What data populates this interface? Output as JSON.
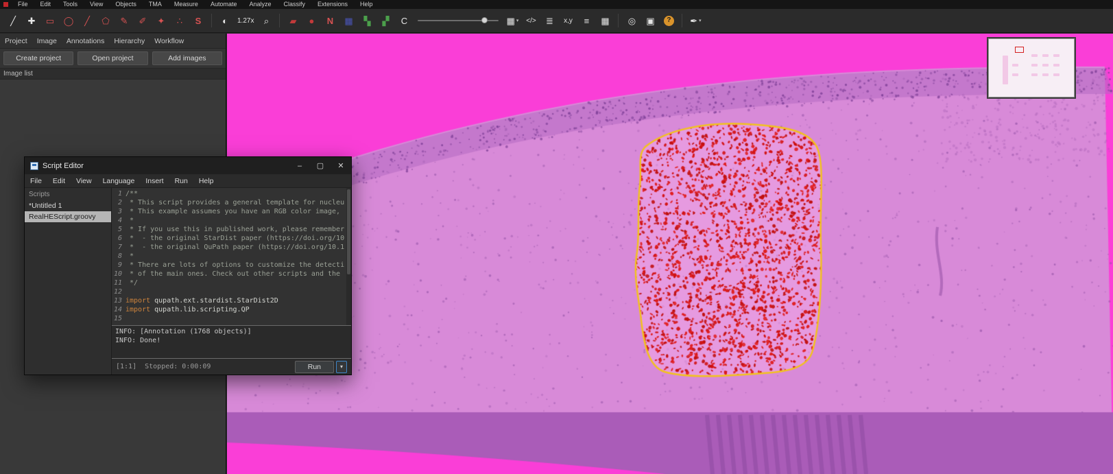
{
  "colors": {
    "accent_selection": "#3f87c9",
    "annotation_stroke": "#f2c21d",
    "nuclei_red": "#d21212",
    "slide_pink": "#fa3ed7",
    "tissue_purple": "#d88ad8",
    "tissue_edge": "#b569c2",
    "tissue_dark_band": "#aa5cb8",
    "speckle": "#8f4fa4"
  },
  "menubar": {
    "items": [
      "File",
      "Edit",
      "Tools",
      "View",
      "Objects",
      "TMA",
      "Measure",
      "Automate",
      "Analyze",
      "Classify",
      "Extensions",
      "Help"
    ]
  },
  "toolbar": {
    "icons": [
      {
        "name": "pen-tool-icon",
        "glyph": "╱",
        "color": "#e6e6e6"
      },
      {
        "name": "move-tool-icon",
        "glyph": "✚",
        "color": "#e6e6e6"
      },
      {
        "name": "rectangle-tool-icon",
        "glyph": "▭",
        "color": "#d65252"
      },
      {
        "name": "ellipse-tool-icon",
        "glyph": "◯",
        "color": "#d65252"
      },
      {
        "name": "line-tool-icon",
        "glyph": "╱",
        "color": "#d65252"
      },
      {
        "name": "polygon-tool-icon",
        "glyph": "⬠",
        "color": "#d65252"
      },
      {
        "name": "polyline-tool-icon",
        "glyph": "✎",
        "color": "#d65252"
      },
      {
        "name": "brush-tool-icon",
        "glyph": "✐",
        "color": "#d65252"
      },
      {
        "name": "wand-tool-icon",
        "glyph": "✦",
        "color": "#d65252"
      },
      {
        "name": "points-tool-icon",
        "glyph": "∴",
        "color": "#d65252"
      },
      {
        "name": "selection-mode-icon",
        "glyph": "S",
        "color": "#d65252",
        "bold": true
      },
      {
        "sep": true
      },
      {
        "name": "brightness-contrast-icon",
        "glyph": "◐",
        "color": "#e6e6e6"
      },
      {
        "name": "zoom-level-label",
        "text": "1.27x",
        "static": true
      },
      {
        "name": "zoom-magnifier-icon",
        "glyph": "⌕",
        "color": "#e6e6e6"
      },
      {
        "sep": true
      },
      {
        "name": "show-annotations-icon",
        "glyph": "▰",
        "color": "#c23a3a"
      },
      {
        "name": "fill-annotations-icon",
        "glyph": "●",
        "color": "#c23a3a"
      },
      {
        "name": "show-names-icon",
        "glyph": "N",
        "color": "#d65252",
        "bold": true
      },
      {
        "name": "tma-grid-icon",
        "glyph": "▦",
        "color": "#4a55b8"
      },
      {
        "name": "show-detections-icon",
        "glyph": "▚",
        "color": "#4ba04b"
      },
      {
        "name": "fill-detections-icon",
        "glyph": "▞",
        "color": "#4ba04b"
      },
      {
        "name": "show-connections-icon",
        "glyph": "C",
        "color": "#e6e6e6"
      },
      {
        "name": "opacity-slider",
        "slider": true
      },
      {
        "name": "grid-overlay-icon",
        "glyph": "▦",
        "color": "#e6e6e6",
        "dropdown": true
      },
      {
        "name": "script-editor-icon",
        "text": "</>"
      },
      {
        "name": "workflow-list-icon",
        "glyph": "≣",
        "color": "#e6e6e6"
      },
      {
        "name": "location-icon",
        "text": "x,y"
      },
      {
        "name": "measurement-list-icon",
        "glyph": "≡",
        "color": "#e6e6e6"
      },
      {
        "name": "measurement-table-icon",
        "glyph": "▦",
        "color": "#e6e6e6"
      },
      {
        "sep": true
      },
      {
        "name": "point-counting-icon",
        "glyph": "◎",
        "color": "#e6e6e6"
      },
      {
        "name": "overview-toggle-icon",
        "glyph": "▣",
        "color": "#e6e6e6"
      },
      {
        "name": "help-icon",
        "glyph": "?",
        "badge": "#d9932b"
      },
      {
        "sep": true
      },
      {
        "name": "pin-tool-icon",
        "glyph": "✒",
        "color": "#e6e6e6",
        "dropdown": true
      }
    ]
  },
  "left_panel": {
    "tabs": [
      {
        "label": "Project",
        "name": "tab-project"
      },
      {
        "label": "Image",
        "name": "tab-image"
      },
      {
        "label": "Annotations",
        "name": "tab-annotations"
      },
      {
        "label": "Hierarchy",
        "name": "tab-hierarchy"
      },
      {
        "label": "Workflow",
        "name": "tab-workflow"
      }
    ],
    "buttons": [
      {
        "label": "Create project",
        "name": "create-project-button"
      },
      {
        "label": "Open project",
        "name": "open-project-button"
      },
      {
        "label": "Add images",
        "name": "add-images-button"
      }
    ],
    "image_list_label": "Image list"
  },
  "script_editor": {
    "title": "Script Editor",
    "window_controls": [
      {
        "name": "minimize-button",
        "glyph": "–"
      },
      {
        "name": "maximize-button",
        "glyph": "▢"
      },
      {
        "name": "close-button",
        "glyph": "✕"
      }
    ],
    "menus": [
      "File",
      "Edit",
      "View",
      "Language",
      "Insert",
      "Run",
      "Help"
    ],
    "list_header": "Scripts",
    "scripts": [
      {
        "label": "*Untitled 1",
        "selected": false
      },
      {
        "label": "RealHEScript.groovy",
        "selected": true
      }
    ],
    "code_lines": [
      {
        "n": "1",
        "parts": [
          {
            "t": "/**",
            "c": "comment"
          }
        ]
      },
      {
        "n": "2",
        "parts": [
          {
            "t": " * This script provides a general template for nucleu",
            "c": "comment"
          }
        ]
      },
      {
        "n": "3",
        "parts": [
          {
            "t": " * This example assumes you have an RGB color image, ",
            "c": "comment"
          }
        ]
      },
      {
        "n": "4",
        "parts": [
          {
            "t": " *",
            "c": "comment"
          }
        ]
      },
      {
        "n": "5",
        "parts": [
          {
            "t": " * If you use this in published work, please remember",
            "c": "comment"
          }
        ]
      },
      {
        "n": "6",
        "parts": [
          {
            "t": " *  - the original StarDist paper (https://doi.org/10",
            "c": "comment"
          }
        ]
      },
      {
        "n": "7",
        "parts": [
          {
            "t": " *  - the original QuPath paper (https://doi.org/10.1",
            "c": "comment"
          }
        ]
      },
      {
        "n": "8",
        "parts": [
          {
            "t": " *",
            "c": "comment"
          }
        ]
      },
      {
        "n": "9",
        "parts": [
          {
            "t": " * There are lots of options to customize the detecti",
            "c": "comment"
          }
        ]
      },
      {
        "n": "10",
        "parts": [
          {
            "t": " * of the main ones. Check out other scripts and the ",
            "c": "comment"
          }
        ]
      },
      {
        "n": "11",
        "parts": [
          {
            "t": " */",
            "c": "comment"
          }
        ]
      },
      {
        "n": "12",
        "parts": []
      },
      {
        "n": "13",
        "parts": [
          {
            "t": "import",
            "c": "keyword"
          },
          {
            "t": " qupath.ext.stardist.StarDist2D",
            "c": "plain"
          }
        ]
      },
      {
        "n": "14",
        "parts": [
          {
            "t": "import",
            "c": "keyword"
          },
          {
            "t": " qupath.lib.scripting.QP",
            "c": "plain"
          }
        ]
      },
      {
        "n": "15",
        "parts": []
      }
    ],
    "console_lines": [
      "INFO: [Annotation (1768 objects)]",
      "INFO: Done!"
    ],
    "status": {
      "caret_position": "[1:1]",
      "state": "Stopped: 0:00:09",
      "run_label": "Run",
      "run_more_glyph": "▾"
    }
  }
}
